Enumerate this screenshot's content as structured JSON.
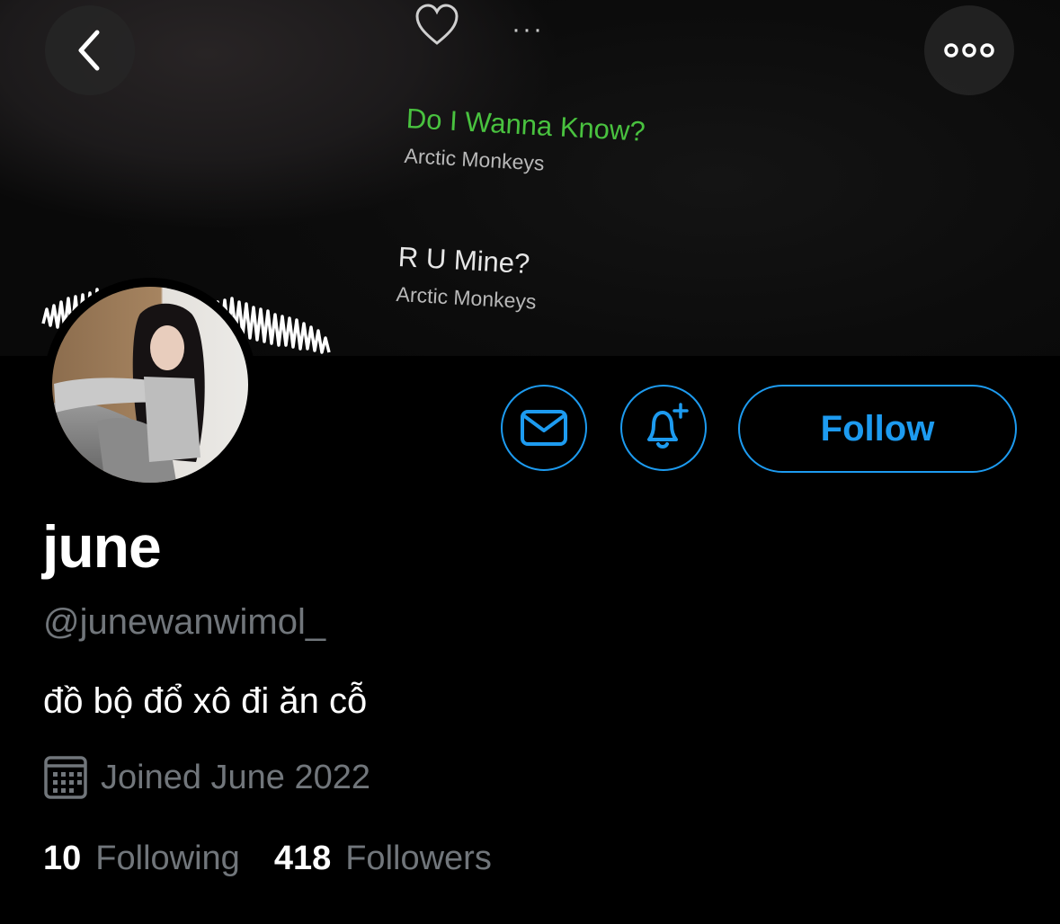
{
  "header": {
    "back_icon": "chevron-left-icon",
    "more_icon": "more-horizontal-icon"
  },
  "banner": {
    "now_playing_dots": "···",
    "tracks": [
      {
        "title": "Do I Wanna Know?",
        "artist": "Arctic Monkeys"
      },
      {
        "title": "R U Mine?",
        "artist": "Arctic Monkeys"
      }
    ],
    "highlight_color": "#49c23f"
  },
  "profile": {
    "display_name": "june",
    "handle": "@junewanwimol_",
    "bio": "đồ bộ đổ xô đi ăn cỗ",
    "joined": "Joined June 2022",
    "following_count": "10",
    "following_label": "Following",
    "followers_count": "418",
    "followers_label": "Followers"
  },
  "actions": {
    "follow_label": "Follow",
    "message_icon": "envelope-icon",
    "notify_icon": "bell-plus-icon"
  },
  "colors": {
    "accent": "#1d9bf0",
    "muted": "#71767b",
    "background": "#000000"
  }
}
